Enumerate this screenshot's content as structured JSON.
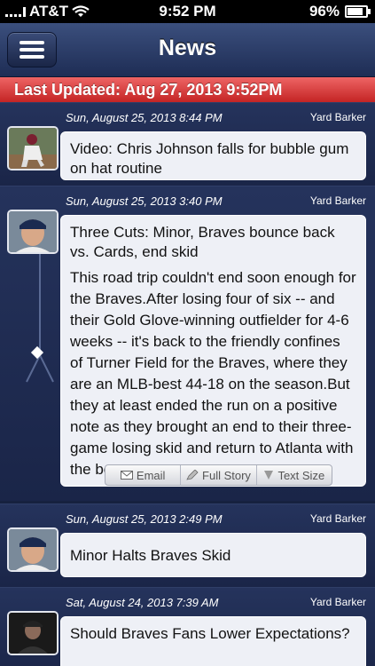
{
  "statusbar": {
    "carrier": "AT&T",
    "time": "9:52 PM",
    "battery": "96%"
  },
  "navbar": {
    "title": "News"
  },
  "banner": {
    "text": "Last Updated: Aug 27, 2013 9:52PM"
  },
  "articles": [
    {
      "date": "Sun, August 25, 2013 8:44 PM",
      "source": "Yard Barker",
      "headline": "Video: Chris Johnson falls for bubble gum on hat routine"
    },
    {
      "date": "Sun, August 25, 2013 3:40 PM",
      "source": "Yard Barker",
      "headline": "Three Cuts: Minor, Braves bounce back vs. Cards, end skid",
      "body": "This road trip couldn't end soon enough for the Braves.After losing four of six -- and their Gold Glove-winning outfielder for 4-6 weeks -- it's back to the friendly confines of Turner Field for the Braves, where they are an MLB-best 44-18 on the season.But they at least ended the run on a positive note as they brought an end to their three-game losing skid and return to Atlanta with the best"
    },
    {
      "date": "Sun, August 25, 2013 2:49 PM",
      "source": "Yard Barker",
      "headline": "Minor Halts Braves Skid"
    },
    {
      "date": "Sat, August 24, 2013 7:39 AM",
      "source": "Yard Barker",
      "headline": "Should Braves Fans Lower Expectations?"
    }
  ],
  "actions": {
    "email": "Email",
    "full_story": "Full Story",
    "text_size": "Text Size"
  },
  "icons": [
    "menu-icon",
    "wifi-icon",
    "battery-icon",
    "email-icon",
    "pencil-icon",
    "text-size-icon"
  ]
}
